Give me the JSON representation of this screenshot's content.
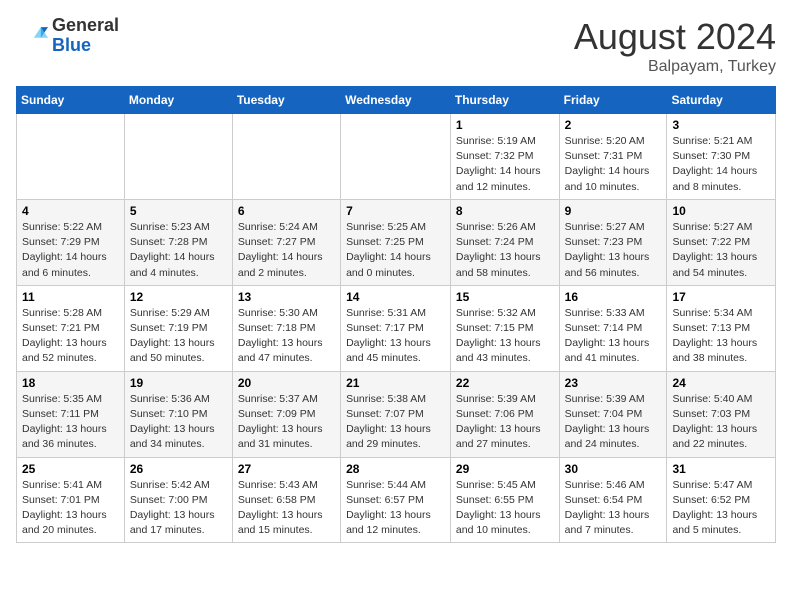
{
  "header": {
    "logo": {
      "general": "General",
      "blue": "Blue"
    },
    "month": "August 2024",
    "location": "Balpayam, Turkey"
  },
  "days_of_week": [
    "Sunday",
    "Monday",
    "Tuesday",
    "Wednesday",
    "Thursday",
    "Friday",
    "Saturday"
  ],
  "weeks": [
    [
      {
        "day": "",
        "info": ""
      },
      {
        "day": "",
        "info": ""
      },
      {
        "day": "",
        "info": ""
      },
      {
        "day": "",
        "info": ""
      },
      {
        "day": "1",
        "info": "Sunrise: 5:19 AM\nSunset: 7:32 PM\nDaylight: 14 hours\nand 12 minutes."
      },
      {
        "day": "2",
        "info": "Sunrise: 5:20 AM\nSunset: 7:31 PM\nDaylight: 14 hours\nand 10 minutes."
      },
      {
        "day": "3",
        "info": "Sunrise: 5:21 AM\nSunset: 7:30 PM\nDaylight: 14 hours\nand 8 minutes."
      }
    ],
    [
      {
        "day": "4",
        "info": "Sunrise: 5:22 AM\nSunset: 7:29 PM\nDaylight: 14 hours\nand 6 minutes."
      },
      {
        "day": "5",
        "info": "Sunrise: 5:23 AM\nSunset: 7:28 PM\nDaylight: 14 hours\nand 4 minutes."
      },
      {
        "day": "6",
        "info": "Sunrise: 5:24 AM\nSunset: 7:27 PM\nDaylight: 14 hours\nand 2 minutes."
      },
      {
        "day": "7",
        "info": "Sunrise: 5:25 AM\nSunset: 7:25 PM\nDaylight: 14 hours\nand 0 minutes."
      },
      {
        "day": "8",
        "info": "Sunrise: 5:26 AM\nSunset: 7:24 PM\nDaylight: 13 hours\nand 58 minutes."
      },
      {
        "day": "9",
        "info": "Sunrise: 5:27 AM\nSunset: 7:23 PM\nDaylight: 13 hours\nand 56 minutes."
      },
      {
        "day": "10",
        "info": "Sunrise: 5:27 AM\nSunset: 7:22 PM\nDaylight: 13 hours\nand 54 minutes."
      }
    ],
    [
      {
        "day": "11",
        "info": "Sunrise: 5:28 AM\nSunset: 7:21 PM\nDaylight: 13 hours\nand 52 minutes."
      },
      {
        "day": "12",
        "info": "Sunrise: 5:29 AM\nSunset: 7:19 PM\nDaylight: 13 hours\nand 50 minutes."
      },
      {
        "day": "13",
        "info": "Sunrise: 5:30 AM\nSunset: 7:18 PM\nDaylight: 13 hours\nand 47 minutes."
      },
      {
        "day": "14",
        "info": "Sunrise: 5:31 AM\nSunset: 7:17 PM\nDaylight: 13 hours\nand 45 minutes."
      },
      {
        "day": "15",
        "info": "Sunrise: 5:32 AM\nSunset: 7:15 PM\nDaylight: 13 hours\nand 43 minutes."
      },
      {
        "day": "16",
        "info": "Sunrise: 5:33 AM\nSunset: 7:14 PM\nDaylight: 13 hours\nand 41 minutes."
      },
      {
        "day": "17",
        "info": "Sunrise: 5:34 AM\nSunset: 7:13 PM\nDaylight: 13 hours\nand 38 minutes."
      }
    ],
    [
      {
        "day": "18",
        "info": "Sunrise: 5:35 AM\nSunset: 7:11 PM\nDaylight: 13 hours\nand 36 minutes."
      },
      {
        "day": "19",
        "info": "Sunrise: 5:36 AM\nSunset: 7:10 PM\nDaylight: 13 hours\nand 34 minutes."
      },
      {
        "day": "20",
        "info": "Sunrise: 5:37 AM\nSunset: 7:09 PM\nDaylight: 13 hours\nand 31 minutes."
      },
      {
        "day": "21",
        "info": "Sunrise: 5:38 AM\nSunset: 7:07 PM\nDaylight: 13 hours\nand 29 minutes."
      },
      {
        "day": "22",
        "info": "Sunrise: 5:39 AM\nSunset: 7:06 PM\nDaylight: 13 hours\nand 27 minutes."
      },
      {
        "day": "23",
        "info": "Sunrise: 5:39 AM\nSunset: 7:04 PM\nDaylight: 13 hours\nand 24 minutes."
      },
      {
        "day": "24",
        "info": "Sunrise: 5:40 AM\nSunset: 7:03 PM\nDaylight: 13 hours\nand 22 minutes."
      }
    ],
    [
      {
        "day": "25",
        "info": "Sunrise: 5:41 AM\nSunset: 7:01 PM\nDaylight: 13 hours\nand 20 minutes."
      },
      {
        "day": "26",
        "info": "Sunrise: 5:42 AM\nSunset: 7:00 PM\nDaylight: 13 hours\nand 17 minutes."
      },
      {
        "day": "27",
        "info": "Sunrise: 5:43 AM\nSunset: 6:58 PM\nDaylight: 13 hours\nand 15 minutes."
      },
      {
        "day": "28",
        "info": "Sunrise: 5:44 AM\nSunset: 6:57 PM\nDaylight: 13 hours\nand 12 minutes."
      },
      {
        "day": "29",
        "info": "Sunrise: 5:45 AM\nSunset: 6:55 PM\nDaylight: 13 hours\nand 10 minutes."
      },
      {
        "day": "30",
        "info": "Sunrise: 5:46 AM\nSunset: 6:54 PM\nDaylight: 13 hours\nand 7 minutes."
      },
      {
        "day": "31",
        "info": "Sunrise: 5:47 AM\nSunset: 6:52 PM\nDaylight: 13 hours\nand 5 minutes."
      }
    ]
  ]
}
